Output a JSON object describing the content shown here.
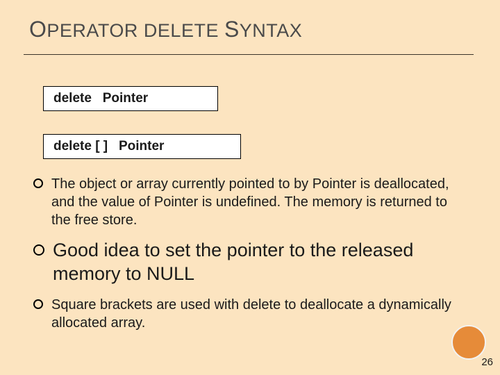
{
  "title_html": "<span class='cap'>O</span>PERATOR DELETE <span class='cap'>S</span>YNTAX",
  "syntax": {
    "line1": "delete   Pointer",
    "line2": "delete [ ]   Pointer"
  },
  "bullets": {
    "b1": "The object or array currently pointed to by Pointer is deallocated, and the value of Pointer is undefined. The memory is returned to the free store.",
    "b2": "Good idea to set the pointer to the released memory to NULL",
    "b3": "Square brackets are used with delete to deallocate a dynamically allocated array."
  },
  "page": "26"
}
